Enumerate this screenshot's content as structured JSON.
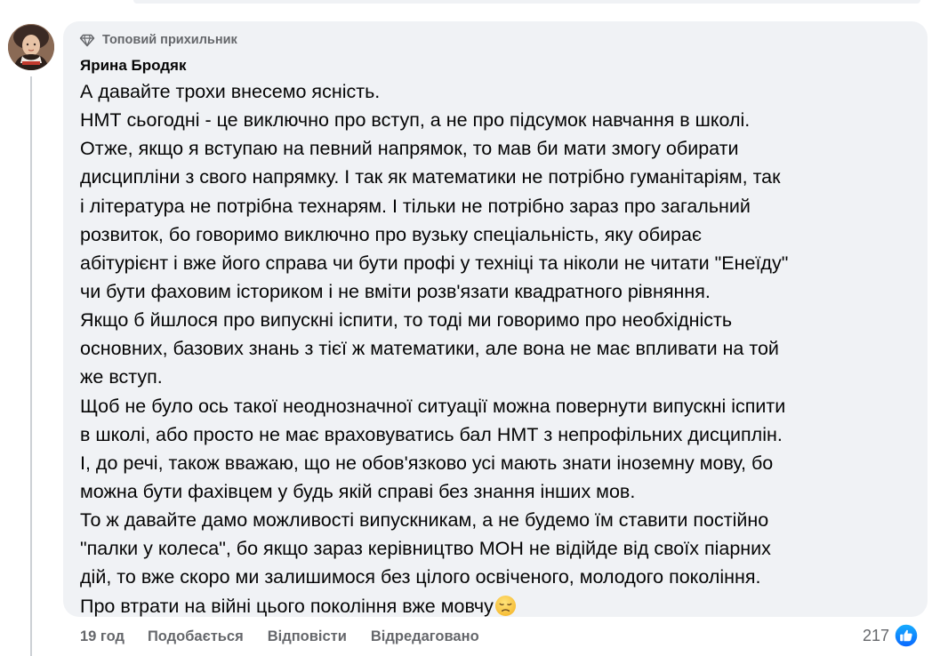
{
  "comment": {
    "badge": {
      "icon": "diamond-icon",
      "label": "Топовий прихильник"
    },
    "author": "Ярина Бродяк",
    "lines": [
      "А давайте трохи внесемо ясність.",
      "НМТ сьогодні - це виключно про вступ, а не про підсумок навчання в школі.",
      "Отже, якщо я вступаю на певний напрямок, то мав би мати змогу обирати",
      "дисципліни з свого напрямку. І так як математики не потрібно гуманітаріям, так",
      "і література не потрібна технарям. І тільки не потрібно зараз про загальний",
      "розвиток, бо говоримо виключно про вузьку спеціальність, яку обирає",
      "абітурієнт і вже його справа чи бути профі у техніці та ніколи не читати \"Енеїду\"",
      "чи бути фаховим істориком і не вміти розв'язати квадратного рівняння.",
      "Якщо б йшлося про випускні іспити, то тоді ми говоримо про необхідність",
      "основних, базових знань з тієї ж математики, але вона не має впливати на той",
      "же вступ.",
      "Щоб не було ось такої неоднозначної ситуації можна повернути випускні іспити",
      "в школі, або просто не має враховуватись бал НМТ з непрофільних дисциплін.",
      "І, до речі, також вважаю, що не обов'язково усі мають знати іноземну мову, бо",
      "можна бути фахівцем у будь якій справі без знання інших мов.",
      "То ж давайте дамо можливості випускникам, а не будемо їм ставити постійно",
      "\"палки у колеса\", бо якщо зараз керівництво МОН не відійде від своїх піарних",
      "дій, то вже скоро ми залишимося без цілого освіченого, молодого покоління.",
      "Про втрати на війні цього покоління вже мовчу"
    ],
    "end_emoji": "disappointed-face-emoji",
    "actions": {
      "time": "19 год",
      "like": "Подобається",
      "reply": "Відповісти",
      "edited": "Відредаговано"
    },
    "reactions": {
      "count": "217",
      "icon": "like-thumb-icon"
    }
  },
  "colors": {
    "bubble": "#f0f2f5",
    "text": "#050505",
    "secondary": "#65676b",
    "like_blue": "#1877f2"
  }
}
